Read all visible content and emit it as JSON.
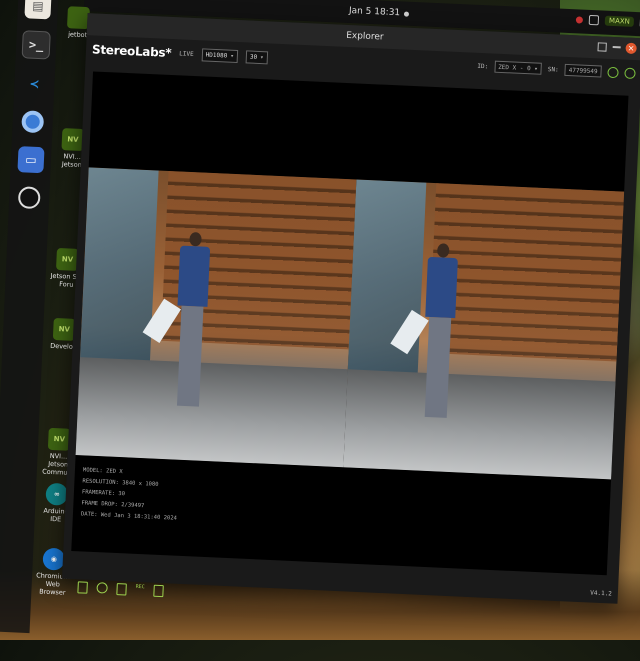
{
  "topbar": {
    "clock": "Jan 5 18:31",
    "nvidia_badge": "MAXN"
  },
  "dock": {
    "items": [
      {
        "name": "Files"
      },
      {
        "name": "Terminal",
        "glyph": ">_"
      },
      {
        "name": "Visual Studio Code",
        "glyph": "≺"
      },
      {
        "name": "Chromium"
      },
      {
        "name": "Text Editor"
      },
      {
        "name": "OBS Studio"
      }
    ]
  },
  "desktop_icons": [
    {
      "label": "jetbot"
    },
    {
      "label": "NVI... Jetson"
    },
    {
      "label": "Jetson S... Foru"
    },
    {
      "label": "Develop"
    },
    {
      "label": "NVI... Jetson Communi"
    },
    {
      "label": "Arduino IDE"
    },
    {
      "label": "Chromium Web Browser"
    }
  ],
  "window": {
    "title": "Explorer",
    "brand": "StereoLabs*",
    "live": "LIVE",
    "resolution": "HD1080",
    "fps": "30",
    "right": {
      "id_label": "ID:",
      "device": "ZED X - 0",
      "sn_label": "SN:",
      "serial": "47799549"
    },
    "info": {
      "model": "MODEL: ZED X",
      "resolution": "RESOLUTION: 3840 x 1080",
      "framerate": "FRAMERATE: 30",
      "frame_drop": "FRAME DROP: 2/39497",
      "date": "DATE: Wed Jan 3 18:31:40 2024"
    },
    "bottom_tool_text": "REC",
    "version": "V4.1.2"
  }
}
